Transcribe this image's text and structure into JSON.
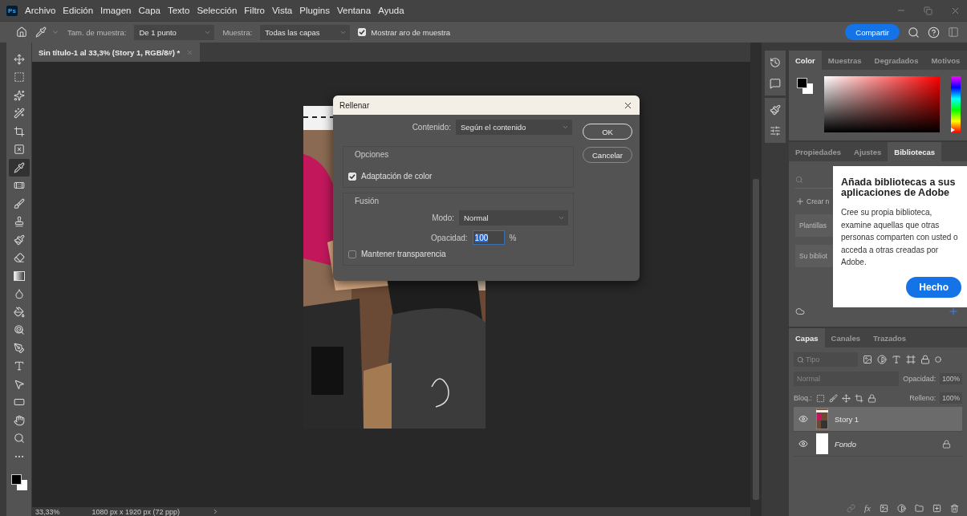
{
  "app_logo": "Ps",
  "menu_bar": {
    "items": [
      "Archivo",
      "Edición",
      "Imagen",
      "Capa",
      "Texto",
      "Selección",
      "Filtro",
      "Vista",
      "Plugins",
      "Ventana",
      "Ayuda"
    ]
  },
  "options_bar": {
    "sample_size": {
      "label": "Tam. de muestra:",
      "value": "De 1 punto"
    },
    "sample": {
      "label": "Muestra:",
      "value": "Todas las capas"
    },
    "show_ring": {
      "label": "Mostrar aro de muestra",
      "checked": true
    },
    "share_button": "Compartir"
  },
  "document_tabs": [
    {
      "title": "Sin título-1 al 33,3% (Story 1, RGB/8#) *",
      "selected": true
    }
  ],
  "tools": [
    {
      "kind": "move",
      "selected": false
    },
    {
      "kind": "marquee",
      "selected": false
    },
    {
      "kind": "quick-select",
      "selected": false
    },
    {
      "kind": "wand",
      "selected": false
    },
    {
      "kind": "crop",
      "selected": false
    },
    {
      "kind": "frame",
      "selected": false
    },
    {
      "kind": "eyedropper",
      "selected": true
    },
    {
      "kind": "healing",
      "selected": false
    },
    {
      "kind": "brush",
      "selected": false
    },
    {
      "kind": "stamp",
      "selected": false
    },
    {
      "kind": "history-brush",
      "selected": false
    },
    {
      "kind": "eraser",
      "selected": false
    },
    {
      "kind": "gradient",
      "selected": false
    },
    {
      "kind": "blur",
      "selected": false
    },
    {
      "kind": "smudge",
      "selected": false
    },
    {
      "kind": "dodge",
      "selected": false
    },
    {
      "kind": "pen",
      "selected": false
    },
    {
      "kind": "type",
      "selected": false
    },
    {
      "kind": "path-select",
      "selected": false
    },
    {
      "kind": "shape",
      "selected": false
    },
    {
      "kind": "hand",
      "selected": false
    },
    {
      "kind": "zoom",
      "selected": false
    },
    {
      "kind": "more",
      "selected": false
    }
  ],
  "fill_dialog": {
    "title": "Rellenar",
    "content": {
      "label": "Contenido:",
      "value": "Según el contenido"
    },
    "buttons": [
      {
        "label": "OK",
        "default": true
      },
      {
        "label": "Cancelar",
        "default": false
      }
    ],
    "options": {
      "title": "Opciones",
      "color_adaptation": {
        "label": "Adaptación de color",
        "checked": true
      }
    },
    "blending": {
      "title": "Fusión",
      "mode": {
        "label": "Modo:",
        "value": "Normal"
      },
      "opacity": {
        "label": "Opacidad:",
        "value": "100",
        "unit": "%"
      },
      "preserve_transparency": {
        "label": "Mantener transparencia",
        "checked": false
      }
    }
  },
  "color_panel": {
    "tabs": [
      {
        "label": "Color",
        "selected": true
      },
      {
        "label": "Muestras",
        "selected": false
      },
      {
        "label": "Degradados",
        "selected": false
      },
      {
        "label": "Motivos",
        "selected": false
      }
    ],
    "hue_slider": {
      "level": 0.05
    }
  },
  "libraries_panel": {
    "tabs": [
      {
        "label": "Propiedades",
        "selected": false
      },
      {
        "label": "Ajustes",
        "selected": false
      },
      {
        "label": "Bibliotecas",
        "selected": true
      }
    ],
    "create_label": "Crear n",
    "items": [
      "Plantillas",
      "Su bibliot"
    ]
  },
  "libraries_tip": {
    "title": "Añada bibliotecas a sus aplicaciones de Adobe",
    "body": "Cree su propia biblioteca, examine aquellas que otras personas comparten con usted o acceda a otras creadas por Adobe.",
    "button": "Hecho"
  },
  "layers_panel": {
    "tabs": [
      {
        "label": "Capas",
        "selected": true
      },
      {
        "label": "Canales",
        "selected": false
      },
      {
        "label": "Trazados",
        "selected": false
      }
    ],
    "filter_placeholder": "Tipo",
    "blend_mode": "Normal",
    "opacity": {
      "label": "Opacidad:",
      "value": "100%"
    },
    "lock_label": "Bloq.:",
    "fill": {
      "label": "Relleno:",
      "value": "100%"
    },
    "effects_button": "fx",
    "layers": [
      {
        "name": "Story 1",
        "kind": "picture",
        "visible": true,
        "selected": true,
        "locked": false
      },
      {
        "name": "Fondo",
        "kind": "white",
        "visible": true,
        "selected": false,
        "locked": true
      }
    ]
  },
  "status_bar": {
    "zoom": "33,33%",
    "document_size": "1080 px x 1920 px (72 ppp)"
  }
}
